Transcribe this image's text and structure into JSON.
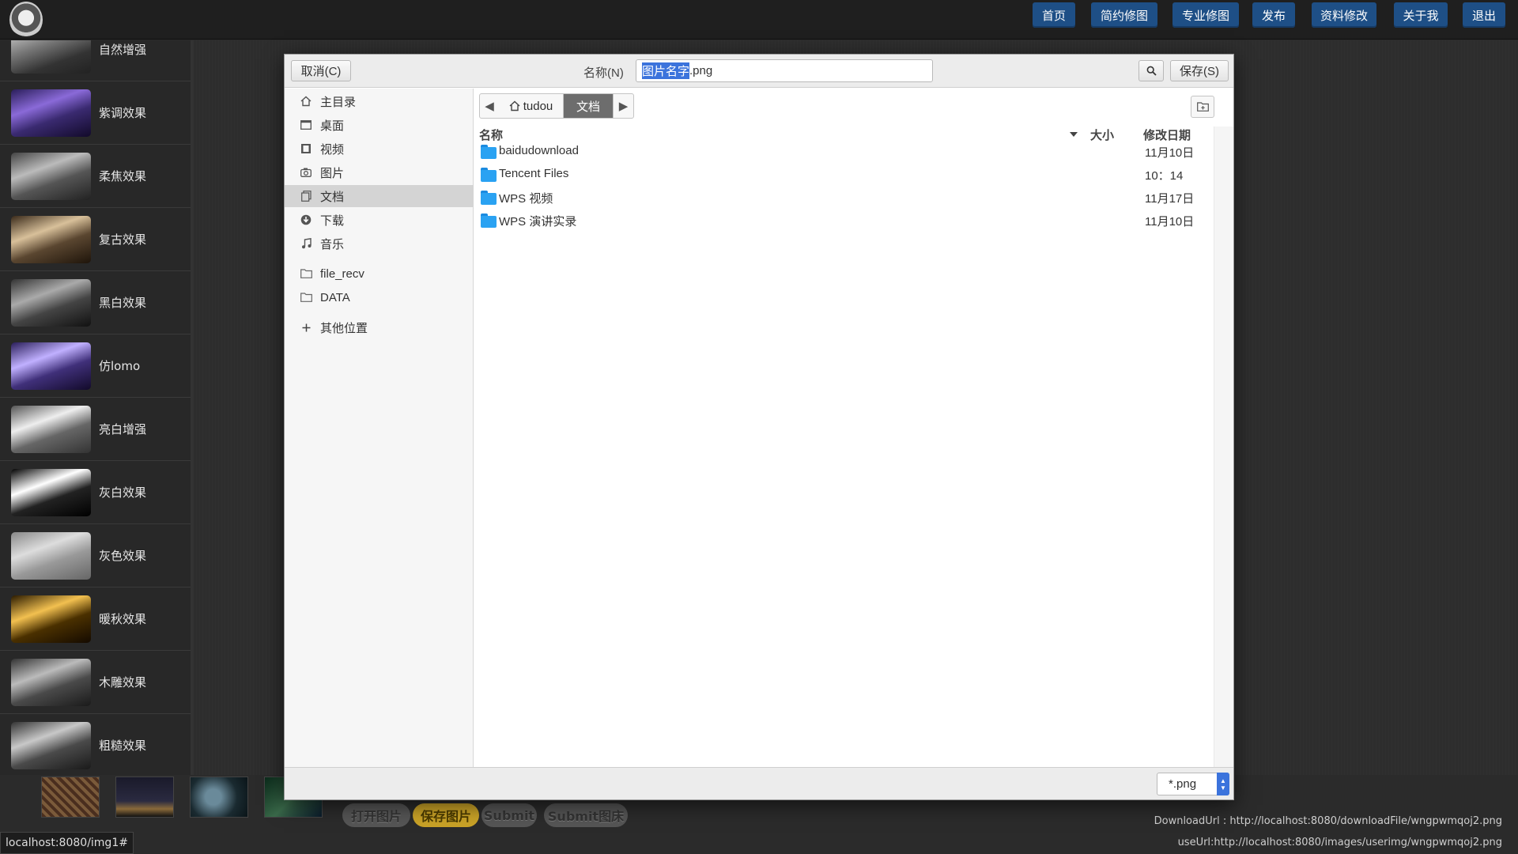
{
  "nav": {
    "buttons": [
      "首页",
      "简约修图",
      "专业修图",
      "发布",
      "资料修改",
      "关于我",
      "退出"
    ]
  },
  "filters": [
    "自然增强",
    "紫调效果",
    "柔焦效果",
    "复古效果",
    "黑白效果",
    "仿lomo",
    "亮白增强",
    "灰白效果",
    "灰色效果",
    "暖秋效果",
    "木雕效果",
    "粗糙效果"
  ],
  "actions": [
    "打开图片",
    "保存图片",
    "Submit",
    "Submit图床"
  ],
  "download_url": "DownloadUrl : http://localhost:8080/downloadFile/wngpwmqoj2.png",
  "use_url": "useUrl:http://localhost:8080/images/userimg/wngpwmqoj2.png",
  "status_url": "localhost:8080/img1#",
  "dialog": {
    "cancel_label": "取消(C)",
    "name_label": "名称(N)",
    "filename_selected": "图片名字",
    "filename_rest": ".png",
    "save_label": "保存(S)",
    "sidebar": [
      "主目录",
      "桌面",
      "视频",
      "图片",
      "文档",
      "下载",
      "音乐"
    ],
    "sidebar_places": [
      "file_recv",
      "DATA"
    ],
    "other_locations": "其他位置",
    "path": {
      "home": "tudou",
      "current": "文档"
    },
    "columns": {
      "name": "名称",
      "size": "大小",
      "modified": "修改日期"
    },
    "files": [
      {
        "name": "baidudownload",
        "date": "11月10日"
      },
      {
        "name": "Tencent Files",
        "date": "10：14"
      },
      {
        "name": "WPS 视频",
        "date": "11月17日"
      },
      {
        "name": "WPS 演讲实录",
        "date": "11月10日"
      }
    ],
    "file_filter": "*.png"
  },
  "colors": {
    "nav_button": "#1e4f86",
    "selection": "#3b73dc",
    "folder": "#2aa2f2",
    "save_button_bg": "#c9a227"
  }
}
